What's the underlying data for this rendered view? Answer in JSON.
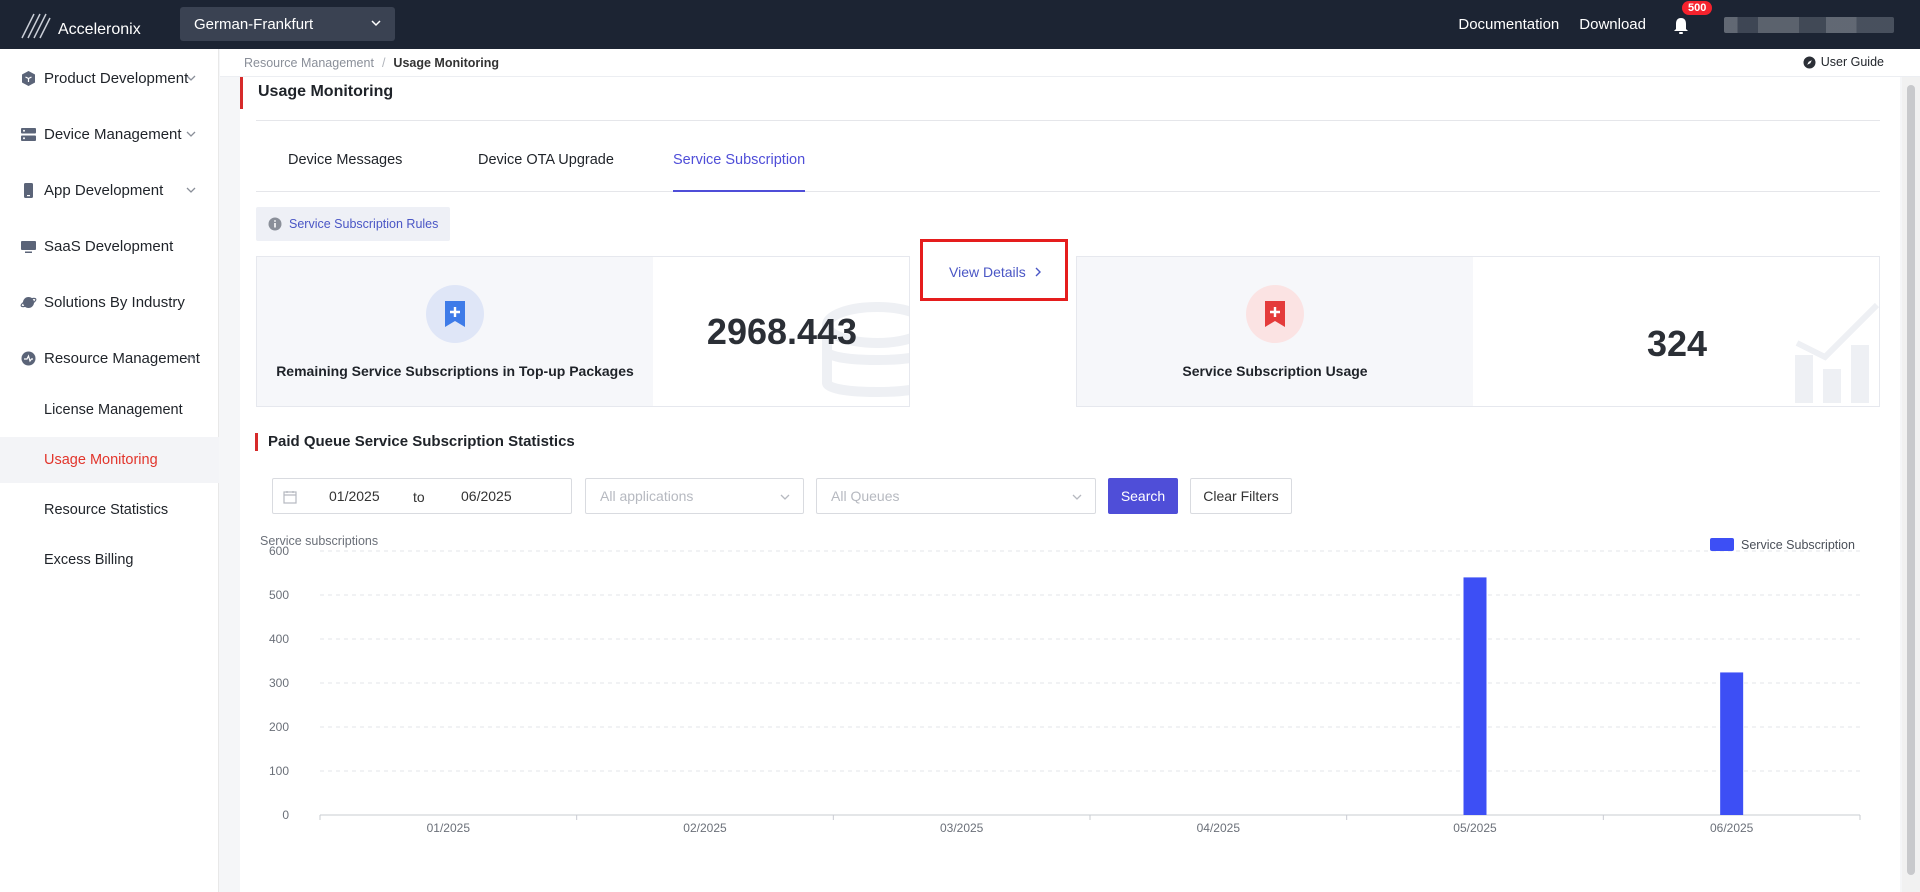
{
  "app": {
    "brand": "Acceleronix",
    "region": "German-Frankfurt"
  },
  "topbar": {
    "documentation": "Documentation",
    "download": "Download",
    "notifications_count": "500"
  },
  "sidebar": {
    "items": [
      {
        "label": "Product Development"
      },
      {
        "label": "Device Management"
      },
      {
        "label": "App Development"
      },
      {
        "label": "SaaS Development"
      },
      {
        "label": "Solutions By Industry"
      },
      {
        "label": "Resource Management"
      }
    ],
    "sub_items": [
      {
        "label": "License Management"
      },
      {
        "label": "Usage Monitoring"
      },
      {
        "label": "Resource Statistics"
      },
      {
        "label": "Excess Billing"
      }
    ]
  },
  "breadcrumb": {
    "parent": "Resource Management",
    "current": "Usage Monitoring",
    "user_guide": "User Guide"
  },
  "page": {
    "title": "Usage Monitoring"
  },
  "tabs": [
    {
      "label": "Device Messages"
    },
    {
      "label": "Device OTA Upgrade"
    },
    {
      "label": "Service Subscription"
    }
  ],
  "rules_tag": "Service Subscription Rules",
  "cards": {
    "remaining": {
      "label": "Remaining Service Subscriptions in Top-up Packages",
      "value": "2968.443",
      "link": "View Details"
    },
    "usage": {
      "label": "Service Subscription Usage",
      "value": "324"
    }
  },
  "stats": {
    "title": "Paid Queue Service Subscription Statistics",
    "date_from": "01/2025",
    "date_to_label": "to",
    "date_to": "06/2025",
    "app_placeholder": "All applications",
    "queue_placeholder": "All Queues",
    "search_label": "Search",
    "clear_label": "Clear Filters"
  },
  "colors": {
    "accent": "#4f4ed8",
    "bar": "#3d4ff5",
    "highlight": "#e51d1d",
    "active_nav": "#e2352c"
  },
  "chart_data": {
    "type": "bar",
    "ylabel": "Service subscriptions",
    "categories": [
      "01/2025",
      "02/2025",
      "03/2025",
      "04/2025",
      "05/2025",
      "06/2025"
    ],
    "series": [
      {
        "name": "Service Subscription",
        "values": [
          0,
          0,
          0,
          0,
          540,
          324
        ]
      }
    ],
    "ylim": [
      0,
      600
    ],
    "yticks": [
      0,
      100,
      200,
      300,
      400,
      500,
      600
    ],
    "grid": true,
    "legend": "top-right"
  }
}
